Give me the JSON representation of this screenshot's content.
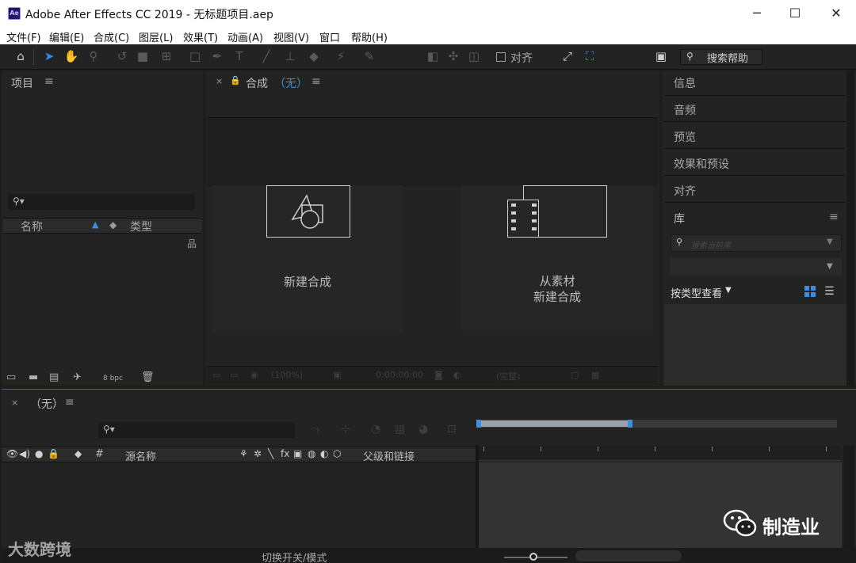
{
  "window": {
    "app_icon": "Ae",
    "title": "Adobe After Effects CC 2019 - 无标题项目.aep",
    "controls": {
      "minimize": "─",
      "maximize": "☐",
      "close": "✕"
    }
  },
  "menu": [
    "文件(F)",
    "编辑(E)",
    "合成(C)",
    "图层(L)",
    "效果(T)",
    "动画(A)",
    "视图(V)",
    "窗口",
    "帮助(H)"
  ],
  "toolbar": {
    "tools": [
      "home-icon",
      "selection-tool-icon",
      "hand-tool-icon",
      "zoom-tool-icon",
      "rotation-tool-icon",
      "camera-tool-icon",
      "pan-behind-icon",
      "rectangle-tool-icon",
      "pen-tool-icon",
      "type-tool-icon",
      "brush-tool-icon",
      "clone-stamp-icon",
      "eraser-tool-icon",
      "roto-brush-icon",
      "puppet-pin-icon"
    ],
    "snap_label": "对齐",
    "search_help": "搜索帮助"
  },
  "project": {
    "title": "项目",
    "columns": {
      "name": "名称",
      "type": "类型"
    },
    "bpc": "8 bpc"
  },
  "composition": {
    "title": "合成",
    "name": "（无）",
    "new_comp": "新建合成",
    "from_footage_line1": "从素材",
    "from_footage_line2": "新建合成",
    "footer_zoom": "(100%)",
    "footer_timecode": "0:00:00:00",
    "footer_res": "(完整)"
  },
  "right_panels": {
    "items": [
      "信息",
      "音频",
      "预览",
      "效果和预设",
      "对齐"
    ],
    "library": {
      "title": "库",
      "search_placeholder": "搜索当前库",
      "view_by": "按类型查看"
    }
  },
  "timeline": {
    "title": "（无）",
    "columns": {
      "hash": "#",
      "source_name": "源名称",
      "parent": "父级和链接"
    },
    "toggle_label": "切换开关/模式",
    "switch_icons": [
      "shy-icon",
      "collapse-icon",
      "quality-icon",
      "fx-icon",
      "frame-blend-icon",
      "motion-blur-icon",
      "adjustment-icon",
      "3d-layer-icon"
    ]
  },
  "watermarks": {
    "left": "大数跨境",
    "right": "制造业"
  },
  "colors": {
    "accent": "#3b8fe3",
    "panel_bg": "#232323",
    "app_bg": "#1d1d1d"
  }
}
